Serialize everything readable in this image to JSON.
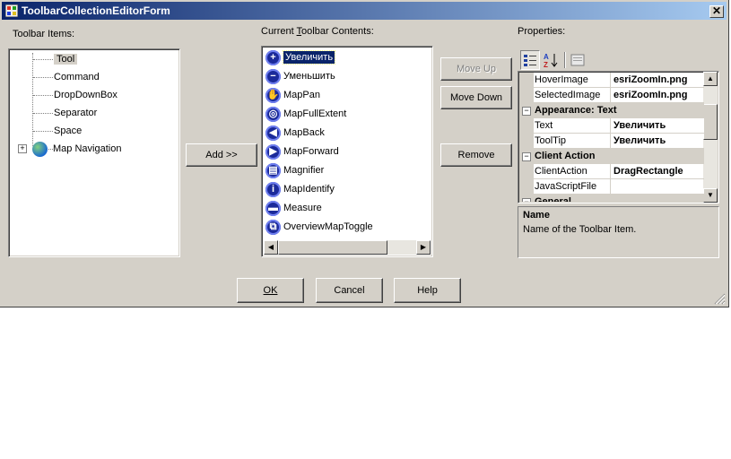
{
  "window": {
    "title": "ToolbarCollectionEditorForm",
    "close_label": "✕"
  },
  "toolbar_items": {
    "label": "Toolbar Items:",
    "items": [
      "Tool",
      "Command",
      "DropDownBox",
      "Separator",
      "Space",
      "Map Navigation"
    ]
  },
  "current_contents": {
    "label": "Current Toolbar Contents:",
    "items": [
      "Увеличить",
      "Уменьшить",
      "MapPan",
      "MapFullExtent",
      "MapBack",
      "MapForward",
      "Magnifier",
      "MapIdentify",
      "Measure",
      "OverviewMapToggle"
    ],
    "selected_index": 0
  },
  "buttons": {
    "add": "Add >>",
    "move_up": "Move Up",
    "move_down": "Move Down",
    "remove": "Remove",
    "ok": "OK",
    "cancel": "Cancel",
    "help": "Help"
  },
  "properties": {
    "label": "Properties:",
    "rows": [
      {
        "kind": "prop",
        "name": "HoverImage",
        "value": "esriZoomIn.png"
      },
      {
        "kind": "prop",
        "name": "SelectedImage",
        "value": "esriZoomIn.png"
      },
      {
        "kind": "cat",
        "name": "Appearance: Text"
      },
      {
        "kind": "prop",
        "name": "Text",
        "value": "Увеличить"
      },
      {
        "kind": "prop",
        "name": "ToolTip",
        "value": "Увеличить"
      },
      {
        "kind": "cat",
        "name": "Client Action"
      },
      {
        "kind": "prop",
        "name": "ClientAction",
        "value": "DragRectangle"
      },
      {
        "kind": "prop",
        "name": "JavaScriptFile",
        "value": ""
      },
      {
        "kind": "cat",
        "name": "General"
      }
    ],
    "description_title": "Name",
    "description_text": "Name of the Toolbar Item."
  }
}
